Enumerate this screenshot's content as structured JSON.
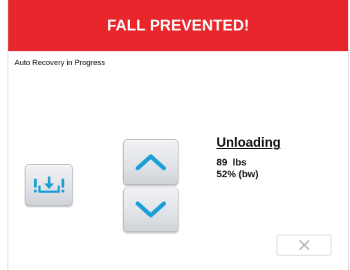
{
  "header": {
    "title": "FALL PREVENTED!",
    "color": "#e8262b"
  },
  "status": {
    "text": "Auto Recovery in Progress"
  },
  "controls": {
    "recovery_button_icon": "unload-recovery-icon",
    "up_button_icon": "chevron-up-icon",
    "down_button_icon": "chevron-down-icon",
    "close_button_icon": "close-icon",
    "accent_color": "#1b9fd8"
  },
  "unloading": {
    "title": "Unloading",
    "weight": "89  lbs",
    "percent": "52% (bw)"
  }
}
